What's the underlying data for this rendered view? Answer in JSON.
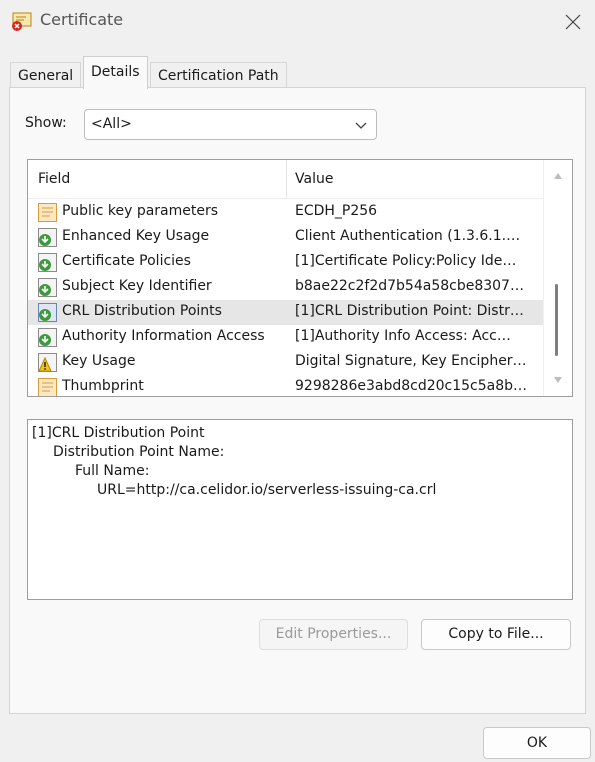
{
  "window": {
    "title": "Certificate",
    "title_icon": "certificate-icon",
    "close_icon": "close-icon"
  },
  "tabs": [
    {
      "label": "General",
      "active": false
    },
    {
      "label": "Details",
      "active": true
    },
    {
      "label": "Certification Path",
      "active": false
    }
  ],
  "show": {
    "label": "Show:",
    "selected": "<All>"
  },
  "list": {
    "headers": {
      "field": "Field",
      "value": "Value"
    },
    "rows": [
      {
        "field": "Public key parameters",
        "value": "ECDH_P256",
        "icon": "property-icon"
      },
      {
        "field": "Enhanced Key Usage",
        "value": "Client Authentication (1.3.6.1.…",
        "icon": "extension-icon"
      },
      {
        "field": "Certificate Policies",
        "value": "[1]Certificate Policy:Policy Ide…",
        "icon": "extension-icon"
      },
      {
        "field": "Subject Key Identifier",
        "value": "b8ae22c2f2d7b54a58cbe8307…",
        "icon": "extension-icon"
      },
      {
        "field": "CRL Distribution Points",
        "value": "[1]CRL Distribution Point: Distr…",
        "icon": "extension-icon",
        "selected": true
      },
      {
        "field": "Authority Information Access",
        "value": "[1]Authority Info Access: Acc…",
        "icon": "extension-icon"
      },
      {
        "field": "Key Usage",
        "value": "Digital Signature, Key Encipher…",
        "icon": "critical-extension-icon"
      },
      {
        "field": "Thumbprint",
        "value": "9298286e3abd8cd20c15c5a8b…",
        "icon": "property-icon"
      }
    ]
  },
  "details": {
    "lines": [
      "[1]CRL Distribution Point",
      "Distribution Point Name:",
      "Full Name:",
      "URL=http://ca.celidor.io/serverless-issuing-ca.crl"
    ]
  },
  "buttons": {
    "edit": "Edit Properties...",
    "copy": "Copy to File...",
    "ok": "OK"
  }
}
